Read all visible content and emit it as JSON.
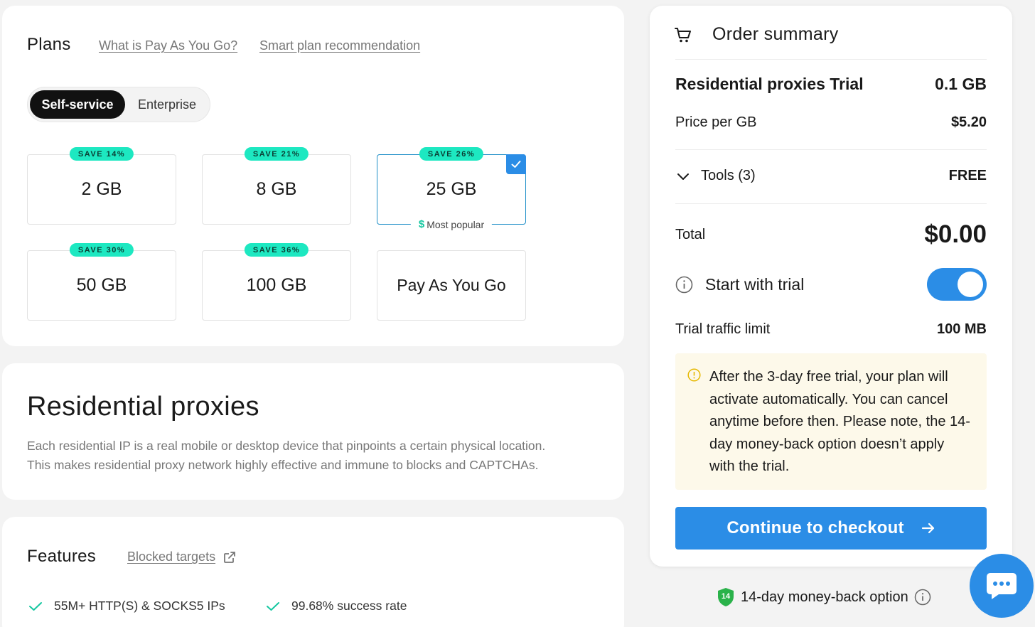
{
  "plans": {
    "title": "Plans",
    "links": {
      "payg": "What is Pay As You Go?",
      "smart": "Smart plan recommendation"
    },
    "segment": {
      "self_service": "Self-service",
      "enterprise": "Enterprise",
      "selected": "Self-service"
    },
    "options": [
      {
        "label": "2 GB",
        "badge": "SAVE 14%"
      },
      {
        "label": "8 GB",
        "badge": "SAVE 21%"
      },
      {
        "label": "25 GB",
        "badge": "SAVE 26%",
        "selected": true,
        "tag": "Most popular"
      },
      {
        "label": "50 GB",
        "badge": "SAVE 30%"
      },
      {
        "label": "100 GB",
        "badge": "SAVE 36%"
      },
      {
        "label": "Pay As You Go"
      }
    ],
    "popular_symbol": "$"
  },
  "residential": {
    "title": "Residential proxies",
    "description_line1": "Each residential IP is a real mobile or desktop device that pinpoints a certain physical location.",
    "description_line2": "This makes residential proxy network highly effective and immune to blocks and CAPTCHAs."
  },
  "features": {
    "title": "Features",
    "blocked_link": "Blocked targets",
    "items": [
      "55M+ HTTP(S) & SOCKS5 IPs",
      "99.68% success rate"
    ]
  },
  "order": {
    "title": "Order summary",
    "product_name": "Residential proxies Trial",
    "product_amount": "0.1 GB",
    "price_label": "Price per GB",
    "price_value": "$5.20",
    "tools_label": "Tools (3)",
    "tools_value": "FREE",
    "total_label": "Total",
    "total_value": "$0.00",
    "trial_label": "Start with trial",
    "trial_enabled": true,
    "limit_label": "Trial traffic limit",
    "limit_value": "100 MB",
    "notice": "After the 3-day free trial, your plan will activate automatically. You can cancel anytime before then. Please note, the 14-day money-back option doesn’t apply with the trial.",
    "checkout_label": "Continue to checkout"
  },
  "moneyback": {
    "badge": "14",
    "label": "14-day money-back option"
  },
  "colors": {
    "accent": "#2b8de6",
    "badge": "#1de8c1",
    "notice_bg": "#fdf9ea",
    "selected_border": "#1f8fc8"
  }
}
